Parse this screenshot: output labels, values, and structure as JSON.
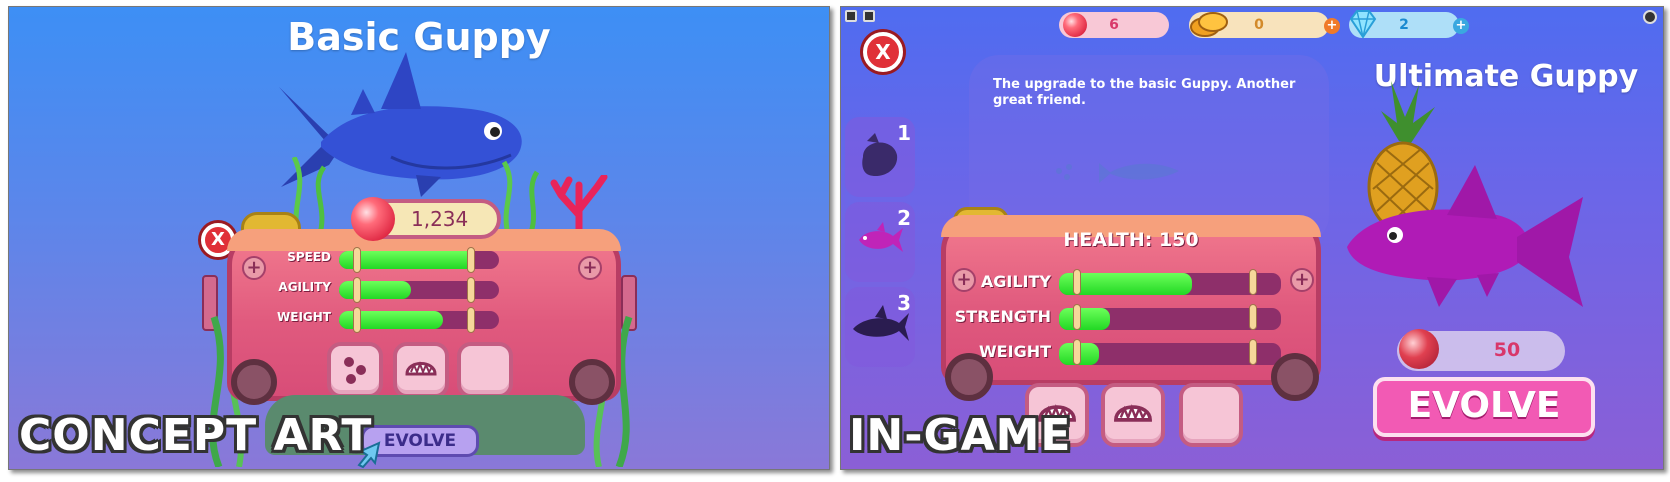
{
  "concept": {
    "fish_name": "Basic Guppy",
    "cost": "1,234",
    "stats": [
      {
        "label": "SPEED",
        "value": 0.85
      },
      {
        "label": "AGILITY",
        "value": 0.45
      },
      {
        "label": "WEIGHT",
        "value": 0.65
      }
    ],
    "evolve_label": "EVOLVE",
    "caption": "CONCEPT ART",
    "close_label": "X"
  },
  "ingame": {
    "currencies": [
      {
        "icon": "pink-orb-icon",
        "value": "6"
      },
      {
        "icon": "gold-coins-icon",
        "value": "0"
      },
      {
        "icon": "diamond-icon",
        "value": "2"
      }
    ],
    "description": "The upgrade to the basic Guppy. Another great friend.",
    "levels": [
      {
        "number": "1"
      },
      {
        "number": "2"
      },
      {
        "number": "3"
      }
    ],
    "health_label": "HEALTH: 150",
    "stats": [
      {
        "label": "AGILITY",
        "value": 0.6
      },
      {
        "label": "STRENGTH",
        "value": 0.23
      },
      {
        "label": "WEIGHT",
        "value": 0.18
      }
    ],
    "fish_name": "Ultimate Guppy",
    "cost": "50",
    "evolve_label": "EVOLVE",
    "caption": "IN-GAME",
    "close_label": "X"
  },
  "colors": {
    "bar_fill": "#22d824",
    "board_pink": "#e05a7e",
    "evolve_pink": "#f25ab4",
    "close_red": "#e03038"
  }
}
